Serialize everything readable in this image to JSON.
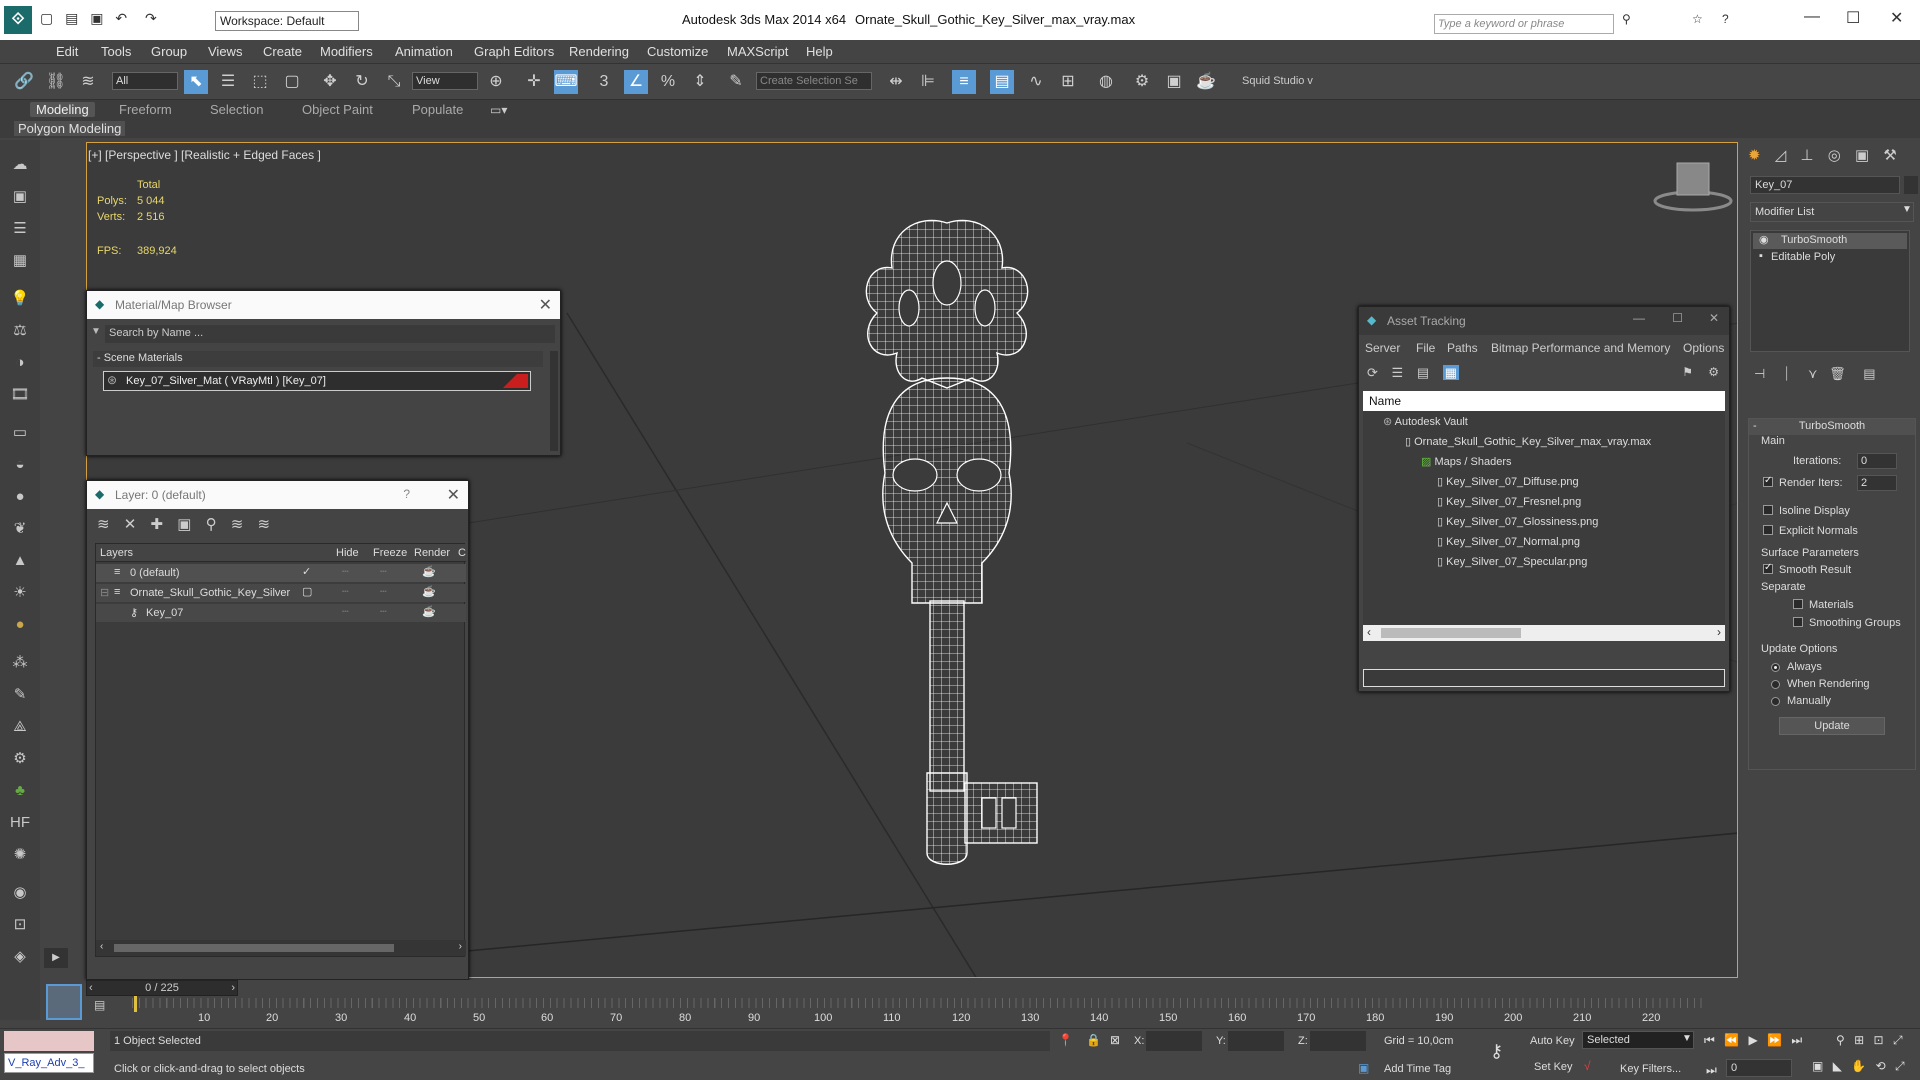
{
  "titlebar": {
    "app": "Autodesk 3ds Max  2014 x64",
    "file": "Ornate_Skull_Gothic_Key_Silver_max_vray.max",
    "workspace": "Workspace: Default",
    "search_placeholder": "Type a keyword or phrase"
  },
  "menu": [
    "Edit",
    "Tools",
    "Group",
    "Views",
    "Create",
    "Modifiers",
    "Animation",
    "Graph Editors",
    "Rendering",
    "Customize",
    "MAXScript",
    "Help"
  ],
  "toolbar": {
    "filter": "All",
    "refcoord": "View",
    "selection_set_placeholder": "Create Selection Se",
    "squid": "Squid Studio v"
  },
  "ribbon": {
    "tabs": [
      "Modeling",
      "Freeform",
      "Selection",
      "Object Paint",
      "Populate"
    ],
    "sub": "Polygon Modeling"
  },
  "viewport": {
    "label": "[+] [Perspective ] [Realistic + Edged Faces ]",
    "stats": {
      "total": "Total",
      "polys_label": "Polys:",
      "polys": "5 044",
      "verts_label": "Verts:",
      "verts": "2 516",
      "fps_label": "FPS:",
      "fps": "389,924"
    }
  },
  "material_browser": {
    "title": "Material/Map Browser",
    "search": "Search by Name ...",
    "group": "- Scene Materials",
    "item": "Key_07_Silver_Mat  ( VRayMtl ) [Key_07]"
  },
  "layer_panel": {
    "title": "Layer: 0 (default)",
    "columns": [
      "Layers",
      "Hide",
      "Freeze",
      "Render",
      "C"
    ],
    "rows": [
      {
        "name": "0 (default)"
      },
      {
        "name": "Ornate_Skull_Gothic_Key_Silver"
      },
      {
        "name": "Key_07"
      }
    ]
  },
  "asset_tracking": {
    "title": "Asset Tracking",
    "menu": [
      "Server",
      "File",
      "Paths",
      "Bitmap Performance and Memory",
      "Options"
    ],
    "col": "Name",
    "items": [
      {
        "name": "Autodesk Vault"
      },
      {
        "name": "Ornate_Skull_Gothic_Key_Silver_max_vray.max"
      },
      {
        "name": "Maps / Shaders"
      },
      {
        "name": "Key_Silver_07_Diffuse.png"
      },
      {
        "name": "Key_Silver_07_Fresnel.png"
      },
      {
        "name": "Key_Silver_07_Glossiness.png"
      },
      {
        "name": "Key_Silver_07_Normal.png"
      },
      {
        "name": "Key_Silver_07_Specular.png"
      }
    ]
  },
  "command_panel": {
    "object_name": "Key_07",
    "modifier_list": "Modifier List",
    "stack": [
      "TurboSmooth",
      "Editable Poly"
    ],
    "rollout": "TurboSmooth",
    "main": "Main",
    "iterations_label": "Iterations:",
    "iterations": "0",
    "render_iters_label": "Render Iters:",
    "render_iters": "2",
    "isoline": "Isoline Display",
    "explicit": "Explicit Normals",
    "surface": "Surface Parameters",
    "smooth": "Smooth Result",
    "separate": "Separate",
    "materials": "Materials",
    "smoothing": "Smoothing Groups",
    "update_options": "Update Options",
    "always": "Always",
    "when_rendering": "When Rendering",
    "manually": "Manually",
    "update": "Update"
  },
  "timeline": {
    "frame": "0 / 225",
    "ticks": [
      "10",
      "20",
      "30",
      "40",
      "50",
      "60",
      "70",
      "80",
      "90",
      "100",
      "110",
      "120",
      "130",
      "140",
      "150",
      "160",
      "170",
      "180",
      "190",
      "200",
      "210",
      "220"
    ]
  },
  "status": {
    "script": "V_Ray_Adv_3_",
    "selected": "1 Object Selected",
    "prompt": "Click or click-and-drag to select objects",
    "x": "X:",
    "y": "Y:",
    "z": "Z:",
    "grid": "Grid = 10,0cm",
    "add_time_tag": "Add Time Tag",
    "auto_key": "Auto Key",
    "set_key": "Set Key",
    "selected_mode": "Selected",
    "key_filters": "Key Filters...",
    "frame_field": "0"
  },
  "colors": {
    "accent_border": "#d4a040",
    "selection_blue": "#5b9bd5",
    "material_swatch": "#c81e1e"
  }
}
